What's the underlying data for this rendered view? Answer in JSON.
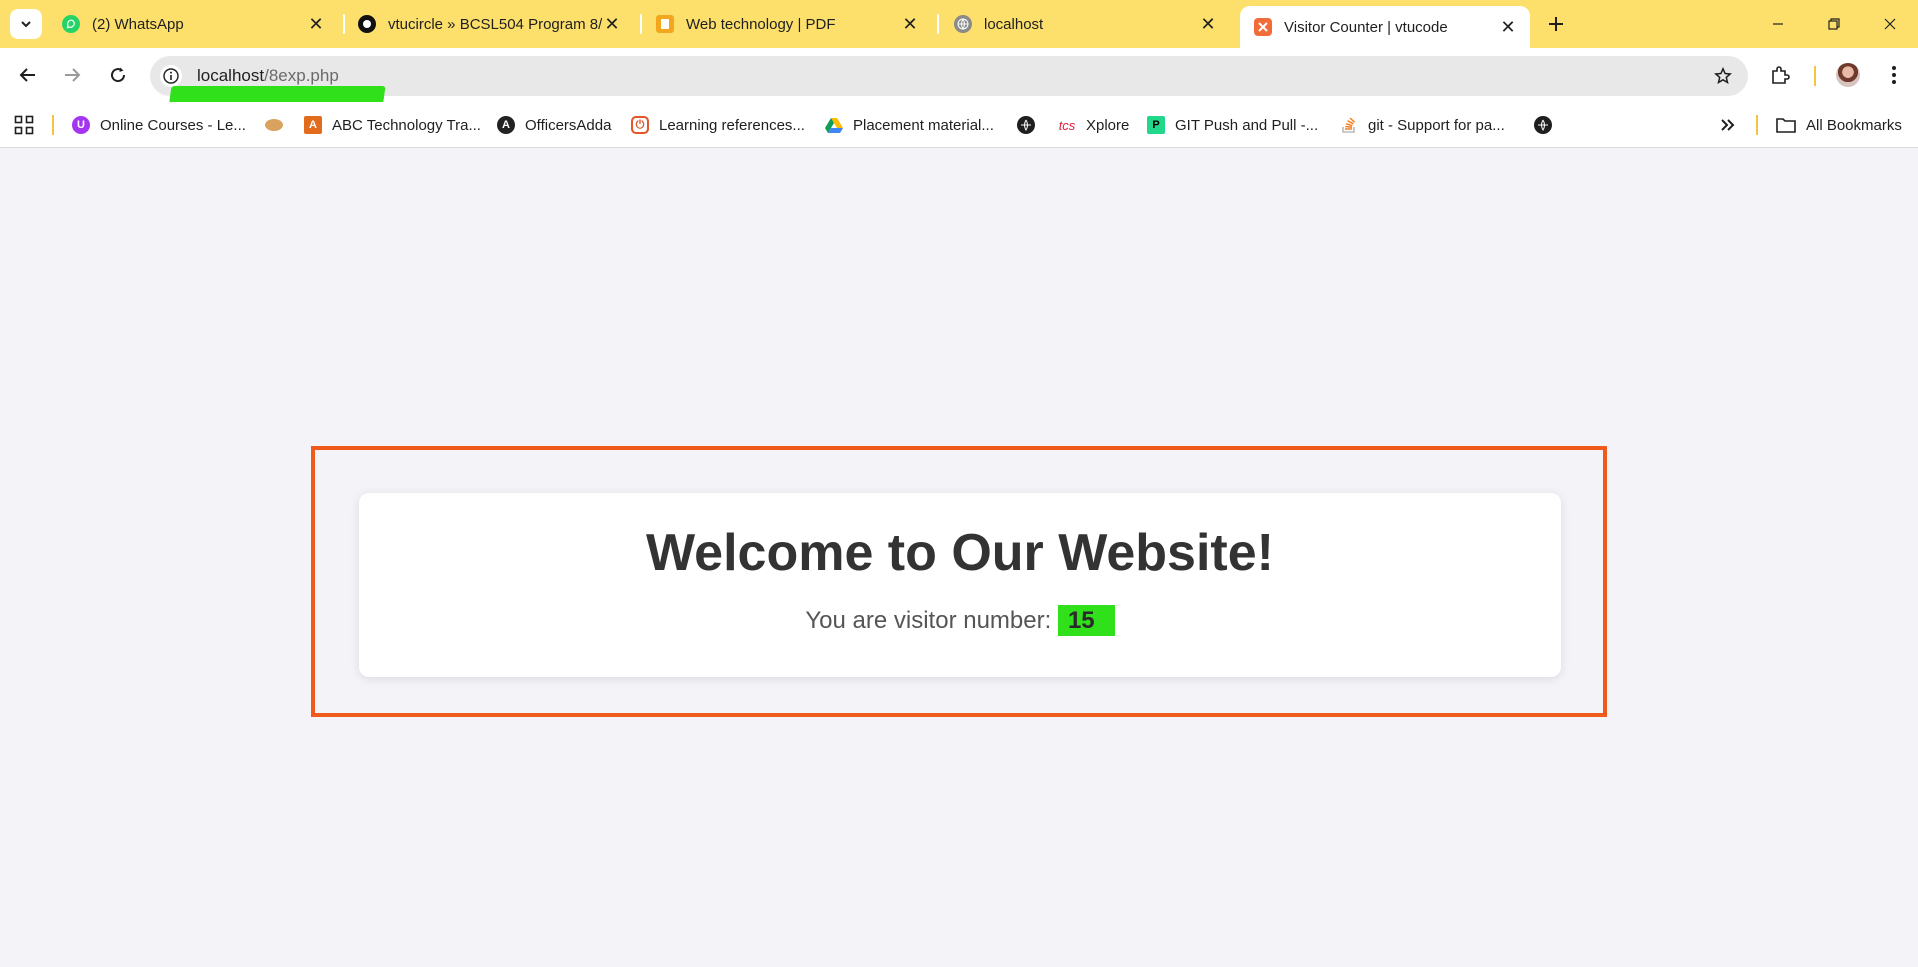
{
  "browser": {
    "tabs": [
      {
        "title": "(2) WhatsApp",
        "icon": "whatsapp-icon",
        "active": false
      },
      {
        "title": "vtucircle » BCSL504 Program 8/",
        "icon": "vtucircle-icon",
        "active": false
      },
      {
        "title": "Web technology | PDF",
        "icon": "pdf-doc-icon",
        "active": false
      },
      {
        "title": "localhost",
        "icon": "globe-icon",
        "active": false
      },
      {
        "title": "Visitor Counter | vtucode",
        "icon": "xampp-icon",
        "active": true
      }
    ],
    "address": {
      "host": "localhost",
      "path": "/8exp.php"
    },
    "bookmarks": [
      {
        "label": "Online Courses - Le...",
        "icon": "udemy-icon"
      },
      {
        "label": "",
        "icon": "emoji-icon"
      },
      {
        "label": "ABC Technology Tra...",
        "icon": "abc-icon"
      },
      {
        "label": "OfficersAdda",
        "icon": "officersadda-icon"
      },
      {
        "label": "Learning references...",
        "icon": "power-icon"
      },
      {
        "label": "Placement material...",
        "icon": "google-drive-icon"
      },
      {
        "label": "",
        "icon": "globe-icon"
      },
      {
        "label": "Xplore",
        "icon": "tcs-icon",
        "prefix": "tcs"
      },
      {
        "label": "GIT Push and Pull -...",
        "icon": "pycharm-icon"
      },
      {
        "label": "git - Support for pa...",
        "icon": "stackoverflow-icon"
      },
      {
        "label": "",
        "icon": "globe-icon"
      }
    ],
    "all_bookmarks_label": "All Bookmarks"
  },
  "page": {
    "heading": "Welcome to Our Website!",
    "visitor_text": "You are visitor number:",
    "visitor_count": "15"
  },
  "colors": {
    "tabstrip": "#fde06b",
    "frame": "#f05a1c",
    "highlight_marker": "#2fe01a"
  }
}
